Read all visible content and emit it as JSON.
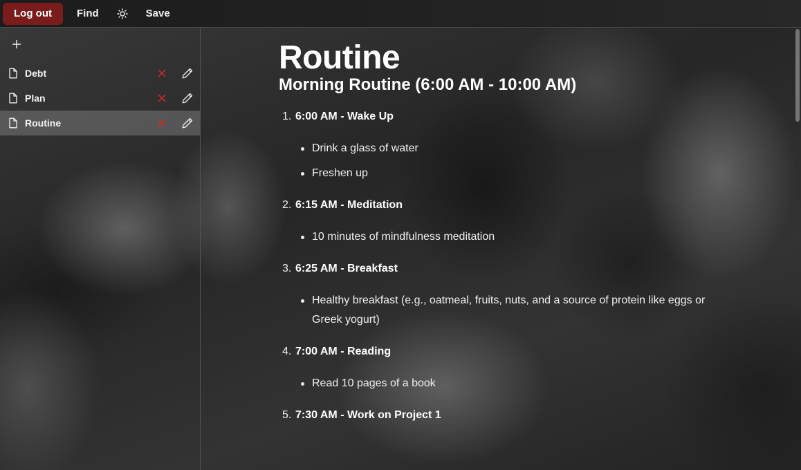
{
  "topbar": {
    "logout_label": "Log out",
    "find_label": "Find",
    "theme_icon": "sun-icon",
    "save_label": "Save",
    "logout_color": "#7a1c1c"
  },
  "sidebar": {
    "add_icon": "plus-icon",
    "notes": [
      {
        "label": "Debt",
        "active": false
      },
      {
        "label": "Plan",
        "active": false
      },
      {
        "label": "Routine",
        "active": true
      }
    ],
    "delete_icon_color": "#e02424"
  },
  "document": {
    "title": "Routine",
    "subtitle": "Morning Routine (6:00 AM - 10:00 AM)",
    "steps": [
      {
        "num": "1.",
        "heading": "6:00 AM - Wake Up",
        "bullets": [
          "Drink a glass of water",
          "Freshen up"
        ]
      },
      {
        "num": "2.",
        "heading": "6:15 AM - Meditation",
        "bullets": [
          "10 minutes of mindfulness meditation"
        ]
      },
      {
        "num": "3.",
        "heading": "6:25 AM - Breakfast",
        "bullets": [
          "Healthy breakfast (e.g., oatmeal, fruits, nuts, and a source of protein like eggs or Greek yogurt)"
        ]
      },
      {
        "num": "4.",
        "heading": "7:00 AM - Reading",
        "bullets": [
          "Read 10 pages of a book"
        ]
      },
      {
        "num": "5.",
        "heading": "7:30 AM - Work on Project 1",
        "bullets": []
      }
    ]
  }
}
